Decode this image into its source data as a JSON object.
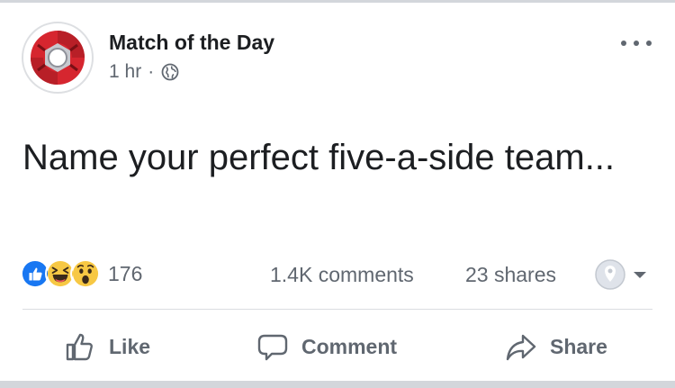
{
  "post": {
    "page_name": "Match of the Day",
    "time": "1 hr",
    "separator": "·",
    "privacy_icon": "globe-icon",
    "more_icon": "more-options-icon",
    "text": "Name your perfect five-a-side team..."
  },
  "stats": {
    "reactions": [
      "like-reaction-icon",
      "haha-reaction-icon",
      "wow-reaction-icon"
    ],
    "reaction_count": "176",
    "comments": "1.4K comments",
    "shares": "23 shares"
  },
  "actions": {
    "like_label": "Like",
    "comment_label": "Comment",
    "share_label": "Share"
  },
  "colors": {
    "facebook_blue": "#1877f2",
    "reaction_yellow": "#f7c844",
    "text_gray": "#606770",
    "divider": "#dadde1"
  }
}
